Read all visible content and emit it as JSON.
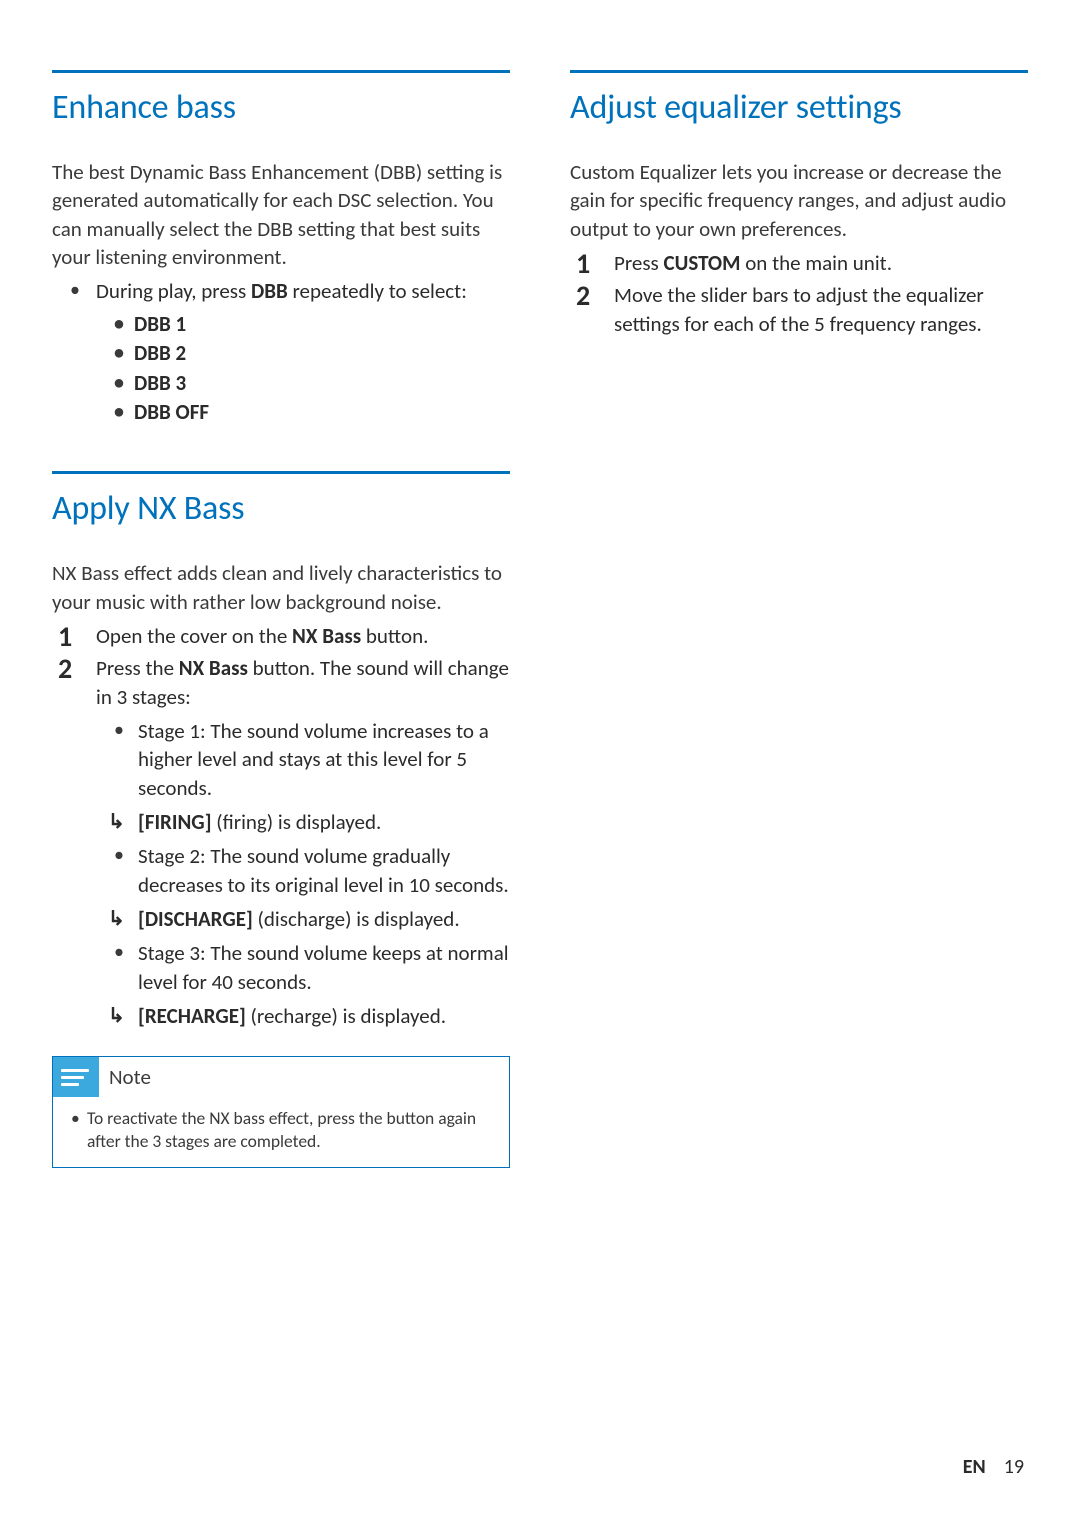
{
  "left": {
    "sec1": {
      "heading": "Enhance bass",
      "intro": "The best Dynamic Bass Enhancement (DBB) setting is generated automatically for each DSC selection. You can manually select the DBB setting that best suits your listening environment.",
      "bullet_pre": "During play, press ",
      "bullet_bold": "DBB",
      "bullet_post": " repeatedly to select:",
      "opts": [
        "DBB 1",
        "DBB 2",
        "DBB 3",
        "DBB OFF"
      ]
    },
    "sec2": {
      "heading": "Apply NX Bass",
      "intro": "NX Bass effect adds clean and lively characteristics to your music with rather low background noise.",
      "step1_pre": "Open the cover on the ",
      "step1_bold": "NX Bass",
      "step1_post": " button.",
      "step2_pre": "Press the ",
      "step2_bold": "NX Bass",
      "step2_post": " button. The sound will change in 3 stages:",
      "stage1": "Stage 1: The sound volume increases to a higher level and stays at this level for 5 seconds.",
      "r1_bold": "[FIRING]",
      "r1_rest": " (firing) is displayed.",
      "stage2": "Stage 2: The sound volume gradually decreases to its original level in 10 seconds.",
      "r2_bold": "[DISCHARGE]",
      "r2_rest": " (discharge) is displayed.",
      "stage3": "Stage 3: The sound volume keeps at normal level for 40 seconds.",
      "r3_bold": "[RECHARGE]",
      "r3_rest": " (recharge) is displayed.",
      "note_title": "Note",
      "note_item": "To reactivate the NX bass effect, press the button again after the 3 stages are completed."
    }
  },
  "right": {
    "heading": "Adjust equalizer settings",
    "intro": "Custom Equalizer lets you increase or decrease the gain for specific frequency ranges, and adjust audio output to your own preferences.",
    "step1_pre": "Press ",
    "step1_bold": "CUSTOM",
    "step1_post": " on the main unit.",
    "step2": "Move the slider bars to adjust the equalizer settings for each of the 5 frequency ranges."
  },
  "footer": {
    "lang": "EN",
    "page": "19"
  }
}
